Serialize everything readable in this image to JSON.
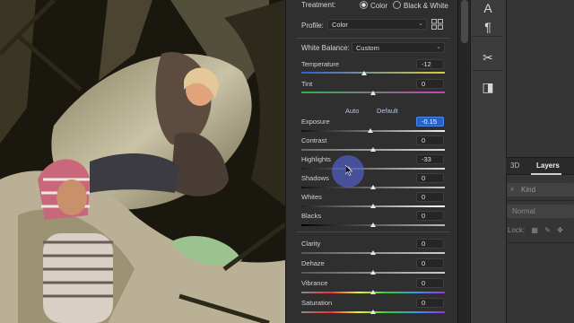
{
  "treatment": {
    "label": "Treatment:",
    "options": [
      "Color",
      "Black & White"
    ],
    "selected": "Color"
  },
  "profile": {
    "label": "Profile:",
    "value": "Color"
  },
  "white_balance": {
    "label": "White Balance:",
    "value": "Custom"
  },
  "sliders_wb": [
    {
      "label": "Temperature",
      "value": "-12",
      "pos": 0.44
    },
    {
      "label": "Tint",
      "value": "0",
      "pos": 0.5
    }
  ],
  "links": {
    "auto": "Auto",
    "default": "Default"
  },
  "sliders_tone": [
    {
      "label": "Exposure",
      "value": "-0.15",
      "active": true,
      "pos": 0.49
    },
    {
      "label": "Contrast",
      "value": "0",
      "pos": 0.5
    },
    {
      "label": "Highlights",
      "value": "-33",
      "pos": 0.34
    },
    {
      "label": "Shadows",
      "value": "0",
      "pos": 0.5
    },
    {
      "label": "Whites",
      "value": "0",
      "pos": 0.5
    },
    {
      "label": "Blacks",
      "value": "0",
      "pos": 0.5
    }
  ],
  "sliders_presence": [
    {
      "label": "Clarity",
      "value": "0",
      "pos": 0.5
    },
    {
      "label": "Dehaze",
      "value": "0",
      "pos": 0.5
    },
    {
      "label": "Vibrance",
      "value": "0",
      "pos": 0.5
    },
    {
      "label": "Saturation",
      "value": "0",
      "pos": 0.5
    }
  ],
  "layers_panel": {
    "tabs": [
      "3D",
      "Layers"
    ],
    "active_tab": "Layers",
    "kind_placeholder": "Kind",
    "blend_mode": "Normal",
    "lock_label": "Lock:"
  },
  "tools": [
    {
      "name": "character-icon",
      "glyph": "A"
    },
    {
      "name": "paragraph-icon",
      "glyph": "¶"
    },
    {
      "name": "tools-icon",
      "glyph": "✂"
    },
    {
      "name": "export-icon",
      "glyph": "◨"
    }
  ],
  "colors": {
    "accent": "#2762c7",
    "halo": "#5a6ef0"
  }
}
